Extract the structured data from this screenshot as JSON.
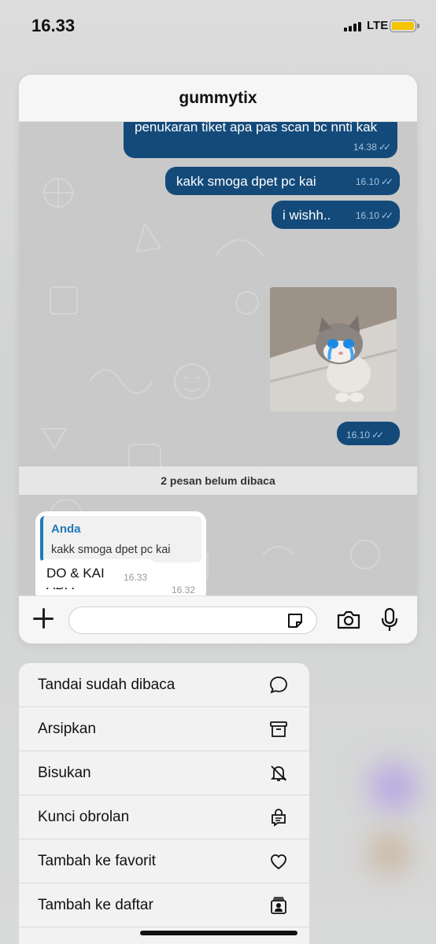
{
  "status_bar": {
    "time": "16.33",
    "network": "LTE"
  },
  "chat": {
    "contact_name": "gummytix",
    "outgoing": [
      {
        "text": "penukaran tiket apa pas scan bc nnti kak",
        "time": "14.38"
      },
      {
        "text": "kakk smoga dpet pc kai",
        "time": "16.10"
      },
      {
        "text": "i wishh..",
        "time": "16.10"
      }
    ],
    "image_message_time": "16.10",
    "unread_banner": "2 pesan belum dibaca",
    "incoming": [
      {
        "quote_sender": "Anda",
        "quote_text": "kakk smoga dpet pc kai",
        "text": "ADA",
        "time": "16.32"
      },
      {
        "text": "DO & KAI",
        "time": "16.33"
      }
    ],
    "input_placeholder": ""
  },
  "menu": {
    "items": [
      {
        "label": "Tandai sudah dibaca",
        "icon": "chat-bubble-icon"
      },
      {
        "label": "Arsipkan",
        "icon": "archive-icon"
      },
      {
        "label": "Bisukan",
        "icon": "bell-slash-icon"
      },
      {
        "label": "Kunci obrolan",
        "icon": "lock-chat-icon"
      },
      {
        "label": "Tambah ke favorit",
        "icon": "heart-icon"
      },
      {
        "label": "Tambah ke daftar",
        "icon": "list-person-icon"
      }
    ]
  },
  "colors": {
    "outgoing_bubble": "#134a7a",
    "accent": "#1f7ab8",
    "battery": "#f5c400"
  }
}
